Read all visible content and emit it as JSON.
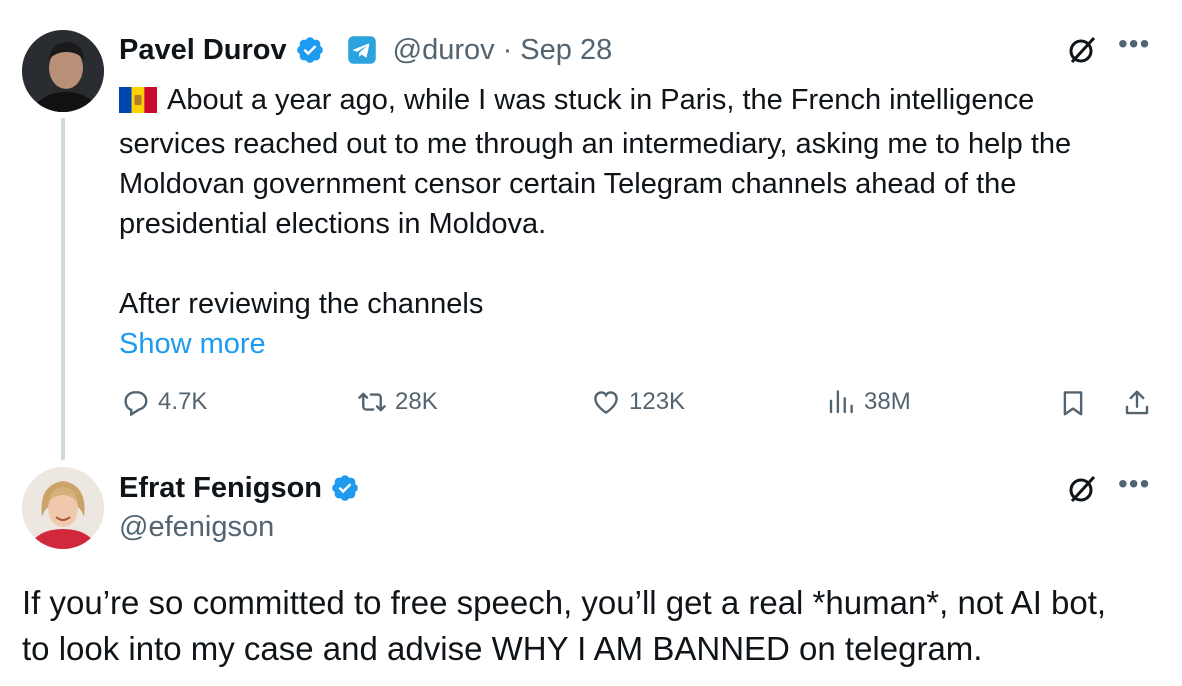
{
  "tweet": {
    "author": {
      "name": "Pavel Durov",
      "handle": "@durov",
      "separator": " · ",
      "date": "Sep 28"
    },
    "text": "About a year ago, while I was stuck in Paris, the French intelligence\nservices reached out to me through an intermediary, asking me to help the\nMoldovan government censor certain Telegram channels ahead of the\npresidential elections in Moldova.\n\nAfter reviewing the channels",
    "show_more": "Show more",
    "stats": {
      "replies": "4.7K",
      "retweets": "28K",
      "likes": "123K",
      "views": "38M"
    }
  },
  "reply": {
    "author": {
      "name": "Efrat Fenigson",
      "handle": "@efenigson"
    },
    "text": "If you’re so committed to free speech, you’ll get a real *human*, not AI bot, to look into my case and advise WHY I AM BANNED on telegram."
  },
  "colors": {
    "accent": "#1d9bf0",
    "muted": "#536471",
    "text": "#0f1419"
  }
}
